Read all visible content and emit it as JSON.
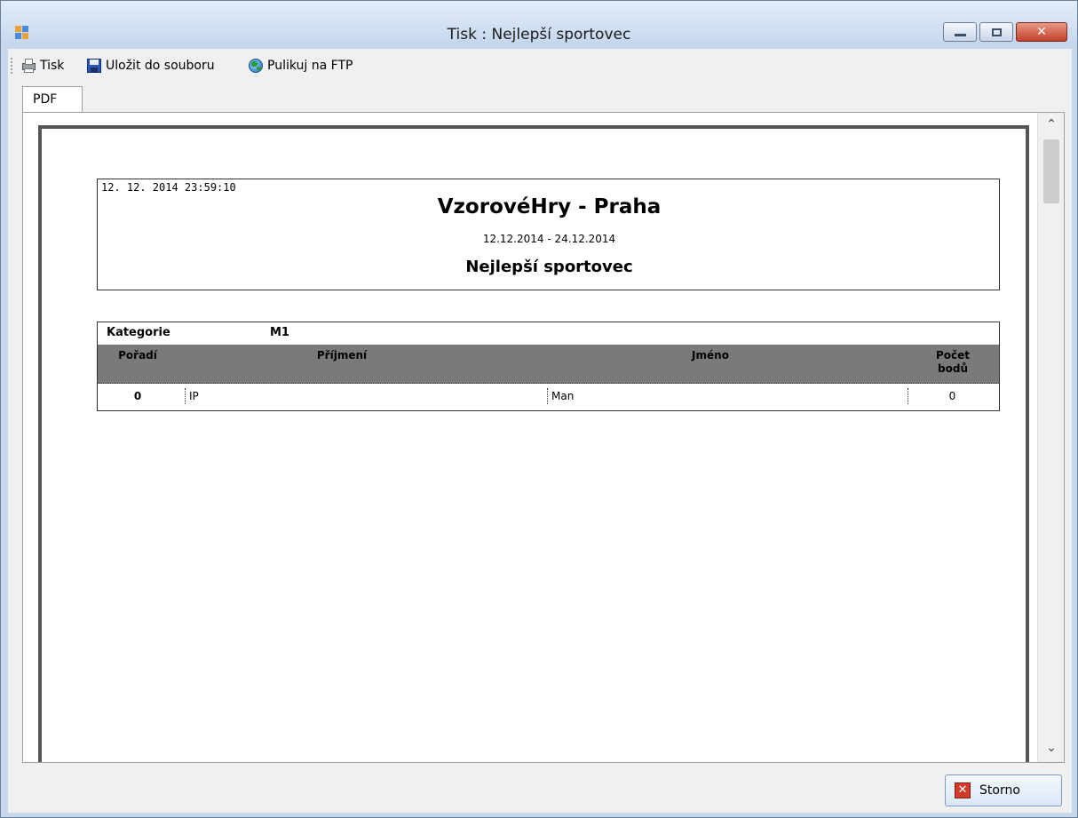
{
  "window": {
    "title": "Tisk : Nejlepší sportovec"
  },
  "toolbar": {
    "print_label": "Tisk",
    "save_label": "Uložit do souboru",
    "publish_label": "Pulikuj na FTP"
  },
  "tabs": [
    {
      "label": "PDF",
      "selected": true
    }
  ],
  "report": {
    "timestamp": "12. 12. 2014 23:59:10",
    "title": "VzorovéHry - Praha",
    "dates": "12.12.2014 - 24.12.2014",
    "subtitle": "Nejlepší sportovec",
    "category_label": "Kategorie",
    "category_value": "M1",
    "columns": [
      "Pořadí",
      "Příjmení",
      "Jméno",
      "Počet\nbodů"
    ],
    "rows": [
      [
        "0",
        "IP",
        "Man",
        "0"
      ]
    ]
  },
  "buttons": {
    "cancel_label": "Storno"
  },
  "colors": {
    "table_header": "#7a7a7a",
    "window_frame": "#c7d8ec",
    "close_button": "#c2412a"
  }
}
